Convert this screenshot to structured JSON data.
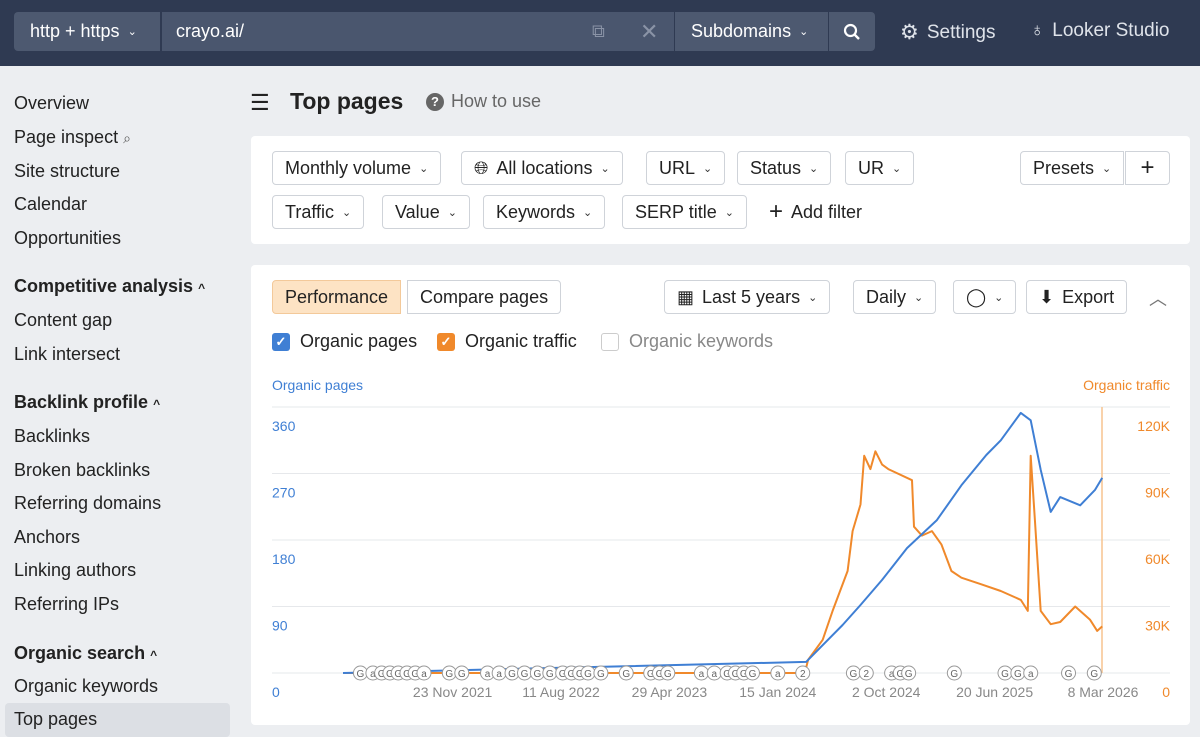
{
  "topbar": {
    "protocol": "http + https",
    "url": "crayo.ai/",
    "mode": "Subdomains",
    "settings": "Settings",
    "looker": "Looker Studio"
  },
  "sidebar": {
    "items_top": [
      "Overview",
      "Page inspect",
      "Site structure",
      "Calendar",
      "Opportunities"
    ],
    "competitive": {
      "title": "Competitive analysis",
      "items": [
        "Content gap",
        "Link intersect"
      ]
    },
    "backlink": {
      "title": "Backlink profile",
      "items": [
        "Backlinks",
        "Broken backlinks",
        "Referring domains",
        "Anchors",
        "Linking authors",
        "Referring IPs"
      ]
    },
    "organic": {
      "title": "Organic search",
      "items": [
        "Organic keywords",
        "Top pages"
      ]
    },
    "active": "Top pages"
  },
  "header": {
    "title": "Top pages",
    "how_to_use": "How to use"
  },
  "filters": {
    "row1": [
      "Monthly volume",
      "All locations",
      "URL",
      "Status",
      "UR"
    ],
    "row2": [
      "Traffic",
      "Value",
      "Keywords",
      "SERP title"
    ],
    "add_filter": "Add filter",
    "presets": "Presets"
  },
  "chart_panel": {
    "tabs": [
      "Performance",
      "Compare pages"
    ],
    "active_tab": "Performance",
    "range": "Last 5 years",
    "granularity": "Daily",
    "export": "Export",
    "checkboxes": [
      {
        "label": "Organic pages",
        "checked": true,
        "color": "#3f7fd4"
      },
      {
        "label": "Organic traffic",
        "checked": true,
        "color": "#f0892b"
      },
      {
        "label": "Organic keywords",
        "checked": false
      }
    ]
  },
  "chart_data": {
    "type": "line",
    "x_range": [
      "2021-03-04",
      "2026-03-08"
    ],
    "x_ticks": [
      "23 Nov 2021",
      "11 Aug 2022",
      "29 Apr 2023",
      "15 Jan 2024",
      "2 Oct 2024",
      "20 Jun 2025",
      "8 Mar 2026"
    ],
    "y_left": {
      "label": "Organic pages",
      "ticks": [
        "0",
        "90",
        "180",
        "270",
        "360"
      ],
      "range": [
        0,
        360
      ],
      "color": "#3f7fd4"
    },
    "y_right": {
      "label": "Organic traffic",
      "ticks": [
        "0",
        "30K",
        "60K",
        "90K",
        "120K"
      ],
      "range": [
        0,
        120000
      ],
      "color": "#f0892b"
    },
    "grid": true,
    "series": [
      {
        "name": "Organic pages",
        "axis": "left",
        "color": "#3f7fd4",
        "points": [
          [
            "2021-03-04",
            0
          ],
          [
            "2024-03-23",
            15
          ],
          [
            "2024-06-19",
            65
          ],
          [
            "2024-08-01",
            92
          ],
          [
            "2024-09-22",
            126
          ],
          [
            "2024-11-21",
            169
          ],
          [
            "2025-02-01",
            207
          ],
          [
            "2025-04-01",
            254
          ],
          [
            "2025-05-31",
            295
          ],
          [
            "2025-07-05",
            315
          ],
          [
            "2025-08-22",
            352
          ],
          [
            "2025-09-15",
            342
          ],
          [
            "2025-10-09",
            275
          ],
          [
            "2025-11-02",
            218
          ],
          [
            "2025-11-25",
            238
          ],
          [
            "2026-01-12",
            227
          ],
          [
            "2026-02-17",
            248
          ],
          [
            "2026-03-06",
            264
          ]
        ]
      },
      {
        "name": "Organic traffic",
        "axis": "right",
        "color": "#f0892b",
        "points": [
          [
            "2021-03-04",
            0
          ],
          [
            "2024-03-20",
            0
          ],
          [
            "2024-03-28",
            5900
          ],
          [
            "2024-05-02",
            15000
          ],
          [
            "2024-05-26",
            28000
          ],
          [
            "2024-07-01",
            46000
          ],
          [
            "2024-07-13",
            64000
          ],
          [
            "2024-08-01",
            76000
          ],
          [
            "2024-08-10",
            98000
          ],
          [
            "2024-08-25",
            92000
          ],
          [
            "2024-09-06",
            100000
          ],
          [
            "2024-09-22",
            94000
          ],
          [
            "2024-10-07",
            92000
          ],
          [
            "2024-12-03",
            87000
          ],
          [
            "2024-12-08",
            66000
          ],
          [
            "2024-12-27",
            62000
          ],
          [
            "2025-01-20",
            64000
          ],
          [
            "2025-02-12",
            58000
          ],
          [
            "2025-03-08",
            46000
          ],
          [
            "2025-04-01",
            43000
          ],
          [
            "2025-05-19",
            40000
          ],
          [
            "2025-07-05",
            37000
          ],
          [
            "2025-08-22",
            33000
          ],
          [
            "2025-09-08",
            28000
          ],
          [
            "2025-09-15",
            98000
          ],
          [
            "2025-09-25",
            69000
          ],
          [
            "2025-10-09",
            28000
          ],
          [
            "2025-11-02",
            22000
          ],
          [
            "2025-11-25",
            23000
          ],
          [
            "2025-12-31",
            30000
          ],
          [
            "2026-02-05",
            24000
          ],
          [
            "2026-02-22",
            19000
          ],
          [
            "2026-03-06",
            21000
          ]
        ]
      }
    ],
    "annotations": [
      [
        "2021-04-15",
        "G"
      ],
      [
        "2021-05-15",
        "a"
      ],
      [
        "2021-06-05",
        "G"
      ],
      [
        "2021-06-25",
        "G"
      ],
      [
        "2021-07-15",
        "G"
      ],
      [
        "2021-08-05",
        "G"
      ],
      [
        "2021-08-25",
        "G"
      ],
      [
        "2021-09-15",
        "a"
      ],
      [
        "2021-11-15",
        "G"
      ],
      [
        "2021-12-15",
        "G"
      ],
      [
        "2022-02-15",
        "a"
      ],
      [
        "2022-03-15",
        "a"
      ],
      [
        "2022-04-15",
        "G"
      ],
      [
        "2022-05-15",
        "G"
      ],
      [
        "2022-06-15",
        "G"
      ],
      [
        "2022-07-15",
        "G"
      ],
      [
        "2022-08-15",
        "G"
      ],
      [
        "2022-09-05",
        "G"
      ],
      [
        "2022-09-25",
        "G"
      ],
      [
        "2022-10-15",
        "G"
      ],
      [
        "2022-11-15",
        "G"
      ],
      [
        "2023-01-15",
        "G"
      ],
      [
        "2023-03-15",
        "G"
      ],
      [
        "2023-04-05",
        "G"
      ],
      [
        "2023-04-25",
        "G"
      ],
      [
        "2023-07-15",
        "a"
      ],
      [
        "2023-08-15",
        "a"
      ],
      [
        "2023-09-15",
        "G"
      ],
      [
        "2023-10-05",
        "G"
      ],
      [
        "2023-10-25",
        "G"
      ],
      [
        "2023-11-15",
        "G"
      ],
      [
        "2024-01-15",
        "a"
      ],
      [
        "2024-03-15",
        "2"
      ],
      [
        "2024-07-15",
        "G"
      ],
      [
        "2024-08-15",
        "2"
      ],
      [
        "2024-10-15",
        "a"
      ],
      [
        "2024-11-05",
        "G"
      ],
      [
        "2024-11-25",
        "G"
      ],
      [
        "2025-03-15",
        "G"
      ],
      [
        "2025-07-15",
        "G"
      ],
      [
        "2025-08-15",
        "G"
      ],
      [
        "2025-09-15",
        "a"
      ],
      [
        "2025-12-15",
        "G"
      ],
      [
        "2026-02-15",
        "G"
      ]
    ]
  }
}
